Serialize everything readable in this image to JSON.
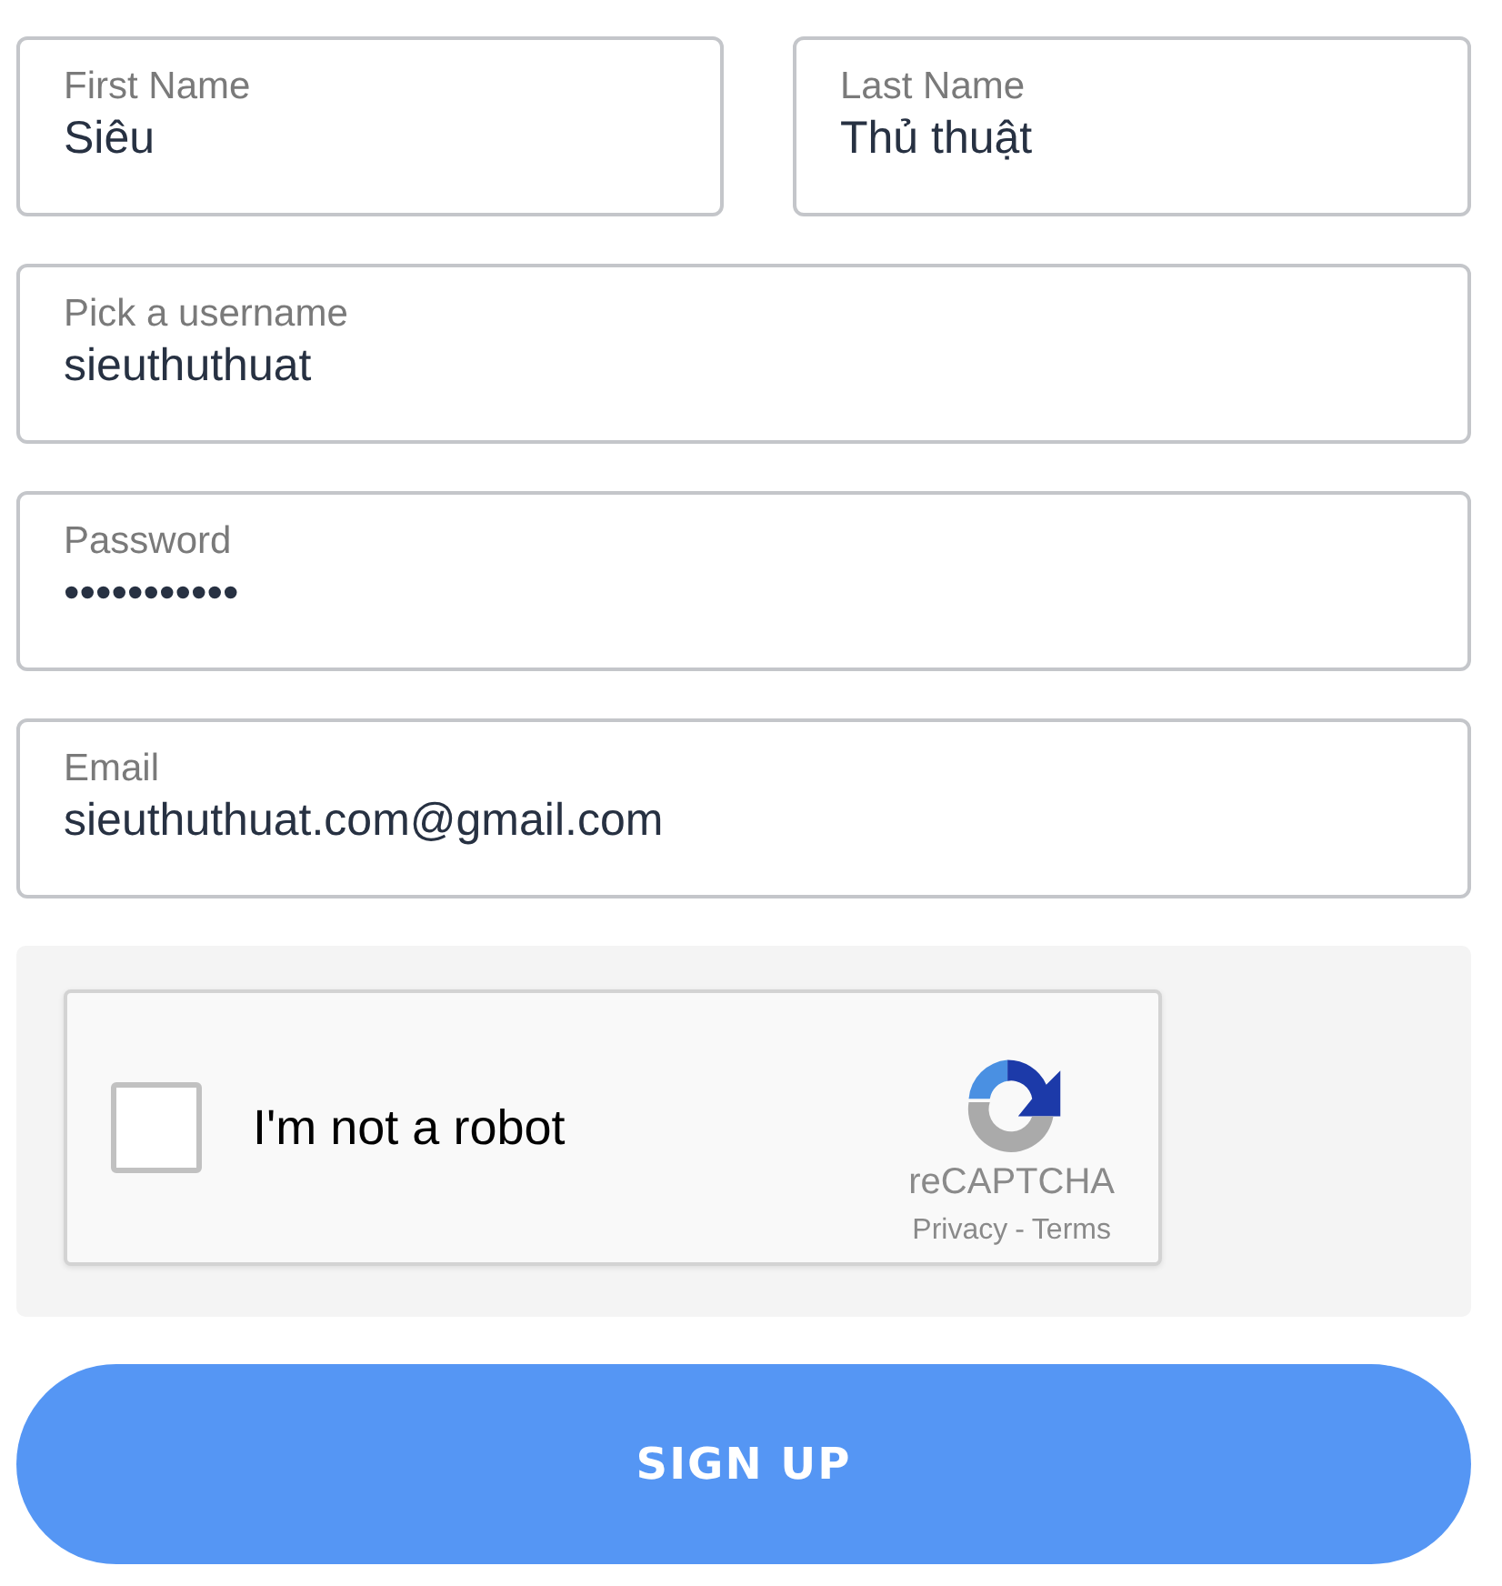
{
  "name_fields": [
    {
      "label": "First Name",
      "value": "Siêu"
    },
    {
      "label": "Last Name",
      "value": "Thủ thuật"
    }
  ],
  "fields": [
    {
      "label": "Pick a username",
      "value": "sieuthuthuat"
    },
    {
      "label": "Password",
      "value": "•••••••••••"
    },
    {
      "label": "Email",
      "value": "sieuthuthuat.com@gmail.com"
    }
  ],
  "captcha": {
    "label": "I'm not a robot",
    "checked": false,
    "brand": "reCAPTCHA",
    "privacy": "Privacy",
    "separator": "-",
    "terms": "Terms"
  },
  "submit": "SIGN UP"
}
